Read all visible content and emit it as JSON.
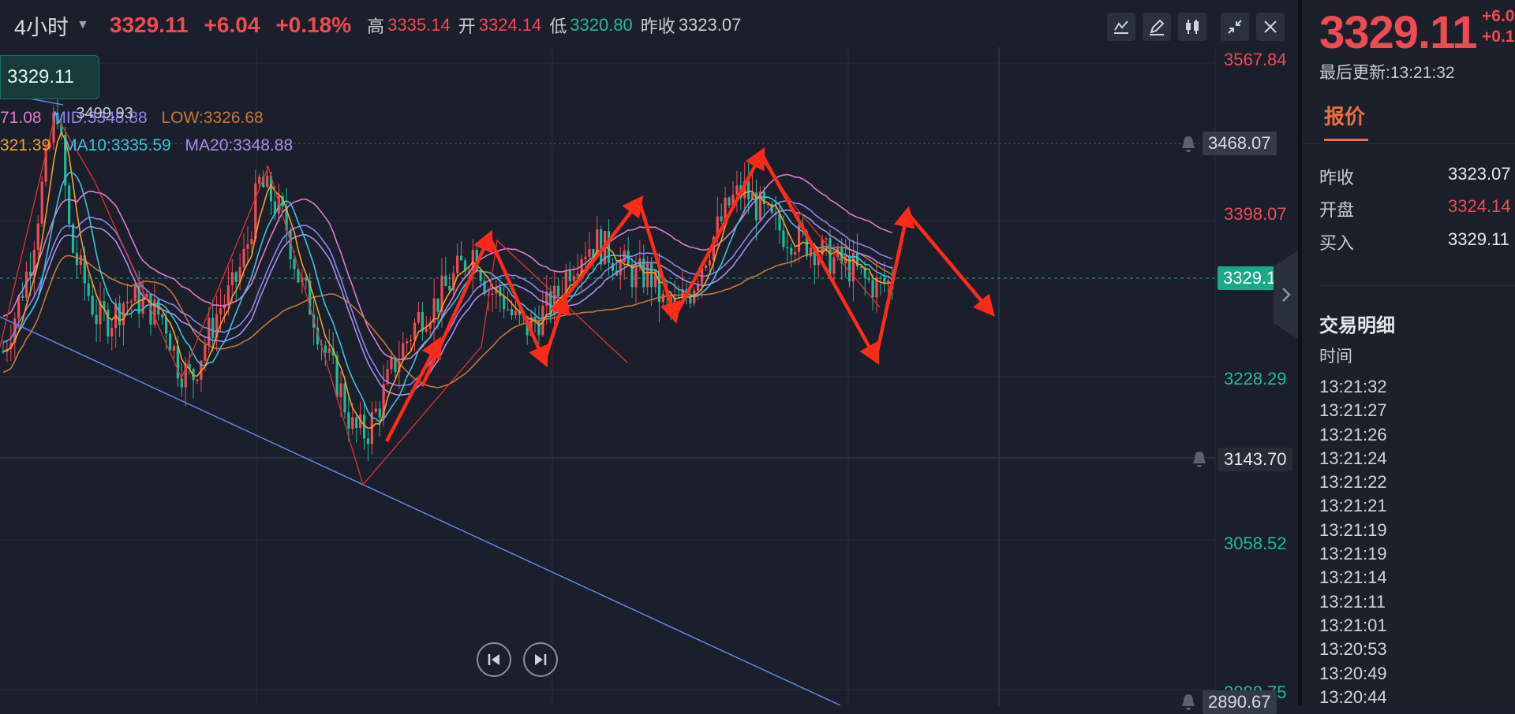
{
  "header": {
    "period": "4小时",
    "last": "3329.11",
    "change": "+6.04",
    "change_pct": "+0.18%",
    "high_label": "高",
    "high": "3335.14",
    "open_label": "开",
    "open": "3324.14",
    "low_label": "低",
    "low": "3320.80",
    "prev_label": "昨收",
    "prev": "3323.07"
  },
  "toolbar": {
    "icons": [
      "indicator-icon",
      "draw-icon",
      "candle-type-icon",
      "collapse-icon",
      "close-icon"
    ]
  },
  "price_pill": "3329.11",
  "legend": {
    "line1": {
      "up": "71.08",
      "mid": "MID:3348.88",
      "overlap": "3499.93",
      "low": "LOW:3326.68"
    },
    "line2": {
      "ma5": "321.39",
      "ma10": "MA10:3335.59",
      "ma20": "MA20:3348.88"
    }
  },
  "axis": {
    "ticks": [
      "3567.84",
      "3398.07",
      "3228.29",
      "3058.52",
      "2888.75"
    ],
    "alert_levels": [
      "3468.07",
      "3143.70",
      "2890.67"
    ],
    "current": "3329.11"
  },
  "colors": {
    "up": "#f04a55",
    "down": "#1dbb95",
    "accent": "#f0703a",
    "ma5": "#f0a030",
    "ma10": "#3ec1de",
    "ma20": "#a98cf0",
    "boll_up": "#e07ad0",
    "boll_mid": "#8c86f0",
    "boll_low": "#c7763a",
    "trend": "#5b88e8",
    "annot": "#ff2a1a"
  },
  "chart_data": {
    "type": "candlestick",
    "x": [],
    "y_range": [
      2888.75,
      3567.84
    ],
    "y_ticks": [
      3567.84,
      3398.07,
      3228.29,
      3058.52,
      2888.75
    ],
    "current_price": 3329.11,
    "close_path_approx": [
      3255,
      3300,
      3352,
      3440,
      3520,
      3370,
      3330,
      3290,
      3290,
      3310,
      3310,
      3300,
      3290,
      3240,
      3225,
      3265,
      3300,
      3320,
      3360,
      3435,
      3418,
      3390,
      3330,
      3298,
      3250,
      3215,
      3170,
      3168,
      3200,
      3240,
      3268,
      3295,
      3305,
      3325,
      3345,
      3365,
      3320,
      3315,
      3287,
      3280,
      3295,
      3310,
      3345,
      3365,
      3372,
      3360,
      3346,
      3335,
      3338,
      3306,
      3302,
      3320,
      3355,
      3385,
      3415,
      3428,
      3410,
      3392,
      3382,
      3375,
      3370,
      3358,
      3350,
      3345,
      3330,
      3325,
      3330
    ],
    "ma_values": {
      "MID": 3348.88,
      "LOW": 3326.68,
      "MA10": 3335.59,
      "MA20": 3348.88
    },
    "grid": true
  },
  "side": {
    "price": "3329.11",
    "change": "+6.0",
    "change_pct": "+0.1",
    "updated_label": "最后更新:",
    "updated": "13:21:32",
    "tab": "报价",
    "quote": [
      {
        "label": "昨收",
        "value": "3323.07",
        "color": "#e6e8ec"
      },
      {
        "label": "开盘",
        "value": "3324.14",
        "color": "#f04a55"
      },
      {
        "label": "买入",
        "value": "3329.11",
        "color": "#e6e8ec"
      }
    ],
    "detail_title": "交易明细",
    "detail_col": "时间",
    "trades": [
      "13:21:32",
      "13:21:27",
      "13:21:26",
      "13:21:24",
      "13:21:22",
      "13:21:21",
      "13:21:19",
      "13:21:19",
      "13:21:14",
      "13:21:11",
      "13:21:01",
      "13:20:53",
      "13:20:49",
      "13:20:44"
    ]
  }
}
